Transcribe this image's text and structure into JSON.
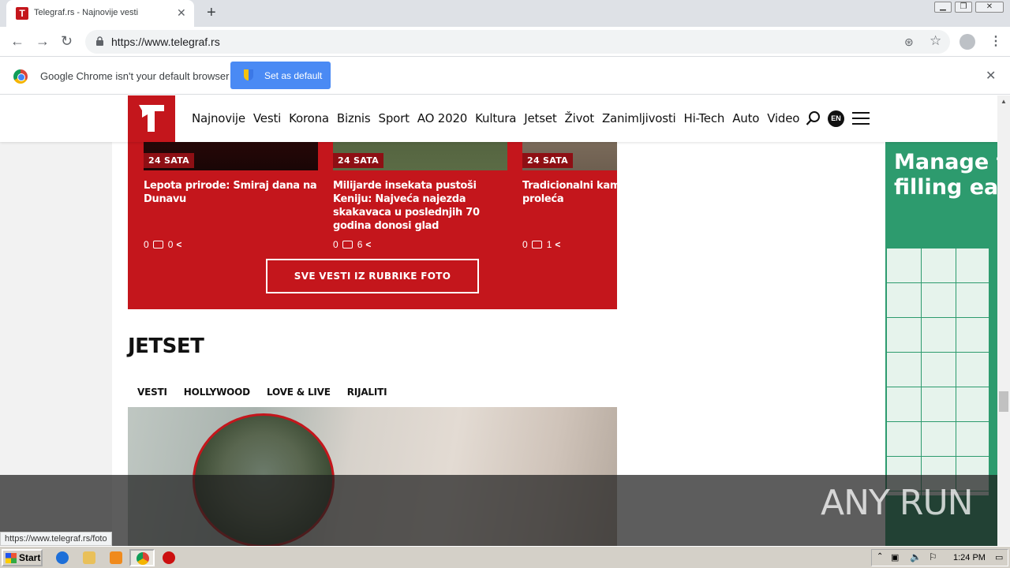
{
  "browser": {
    "tab_title": "Telegraf.rs - Najnovije vesti",
    "tab_favicon_letter": "T",
    "url": "https://www.telegraf.rs",
    "infobar": {
      "message": "Google Chrome isn't your default browser",
      "button": "Set as default"
    },
    "status_url": "https://www.telegraf.rs/foto"
  },
  "site": {
    "brand_color": "#c4161c",
    "nav": [
      "Najnovije",
      "Vesti",
      "Korona",
      "Biznis",
      "Sport",
      "AO 2020",
      "Kultura",
      "Jetset",
      "Život",
      "Zanimljivosti",
      "Hi-Tech",
      "Auto",
      "Video"
    ],
    "language_badge": "EN"
  },
  "foto_section": {
    "cards": [
      {
        "tag": "24 SATA",
        "headline": "Lepota prirode: Smiraj dana na Dunavu",
        "comments": "0",
        "shares": "0"
      },
      {
        "tag": "24 SATA",
        "headline": "Milijarde insekata pustoši Keniju: Najveća najezda skakavaca u poslednjih 70 godina donosi glad",
        "comments": "0",
        "shares": "6"
      },
      {
        "tag": "24 SATA",
        "headline": "Tradicionalni kam za doček proleća",
        "comments": "0",
        "shares": "1"
      }
    ],
    "all_button": "SVE VESTI IZ RUBRIKE FOTO"
  },
  "jetset": {
    "title": "JETSET",
    "tabs": [
      "VESTI",
      "HOLLYWOOD",
      "LOVE & LIVE",
      "RIJALITI"
    ]
  },
  "ad": {
    "line1": "Manage fr",
    "line2": "filling eas"
  },
  "watermark": "ANY RUN",
  "taskbar": {
    "start": "Start",
    "clock": "1:24 PM"
  }
}
